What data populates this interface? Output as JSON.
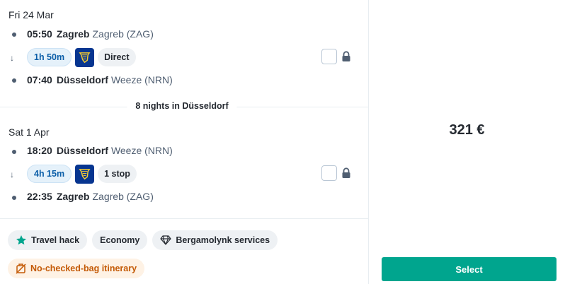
{
  "outbound": {
    "date": "Fri 24 Mar",
    "departure": {
      "time": "05:50",
      "city": "Zagreb",
      "station": "Zagreb (ZAG)"
    },
    "duration": "1h 50m",
    "carrier_icon": "ryanair-harp-icon",
    "stops": "Direct",
    "arrival": {
      "time": "07:40",
      "city": "Düsseldorf",
      "station": "Weeze (NRN)"
    }
  },
  "stay": {
    "label": "8 nights in Düsseldorf"
  },
  "inbound": {
    "date": "Sat 1 Apr",
    "departure": {
      "time": "18:20",
      "city": "Düsseldorf",
      "station": "Weeze (NRN)"
    },
    "duration": "4h 15m",
    "carrier_icon": "ryanair-harp-icon",
    "stops": "1 stop",
    "arrival": {
      "time": "22:35",
      "city": "Zagreb",
      "station": "Zagreb (ZAG)"
    }
  },
  "tags": {
    "travel_hack": "Travel hack",
    "economy": "Economy",
    "services": "Bergamolynk services",
    "no_bag": "No-checked-bag itinerary"
  },
  "price": "321 €",
  "select_label": "Select",
  "colors": {
    "accent": "#00a58e",
    "duration_badge": "#e5f1fa",
    "duration_text": "#0b5ea8",
    "carrier_bg": "#073590",
    "carrier_harp": "#f1c933",
    "warning_bg": "#fef2e5",
    "warning_text": "#c45a06"
  }
}
